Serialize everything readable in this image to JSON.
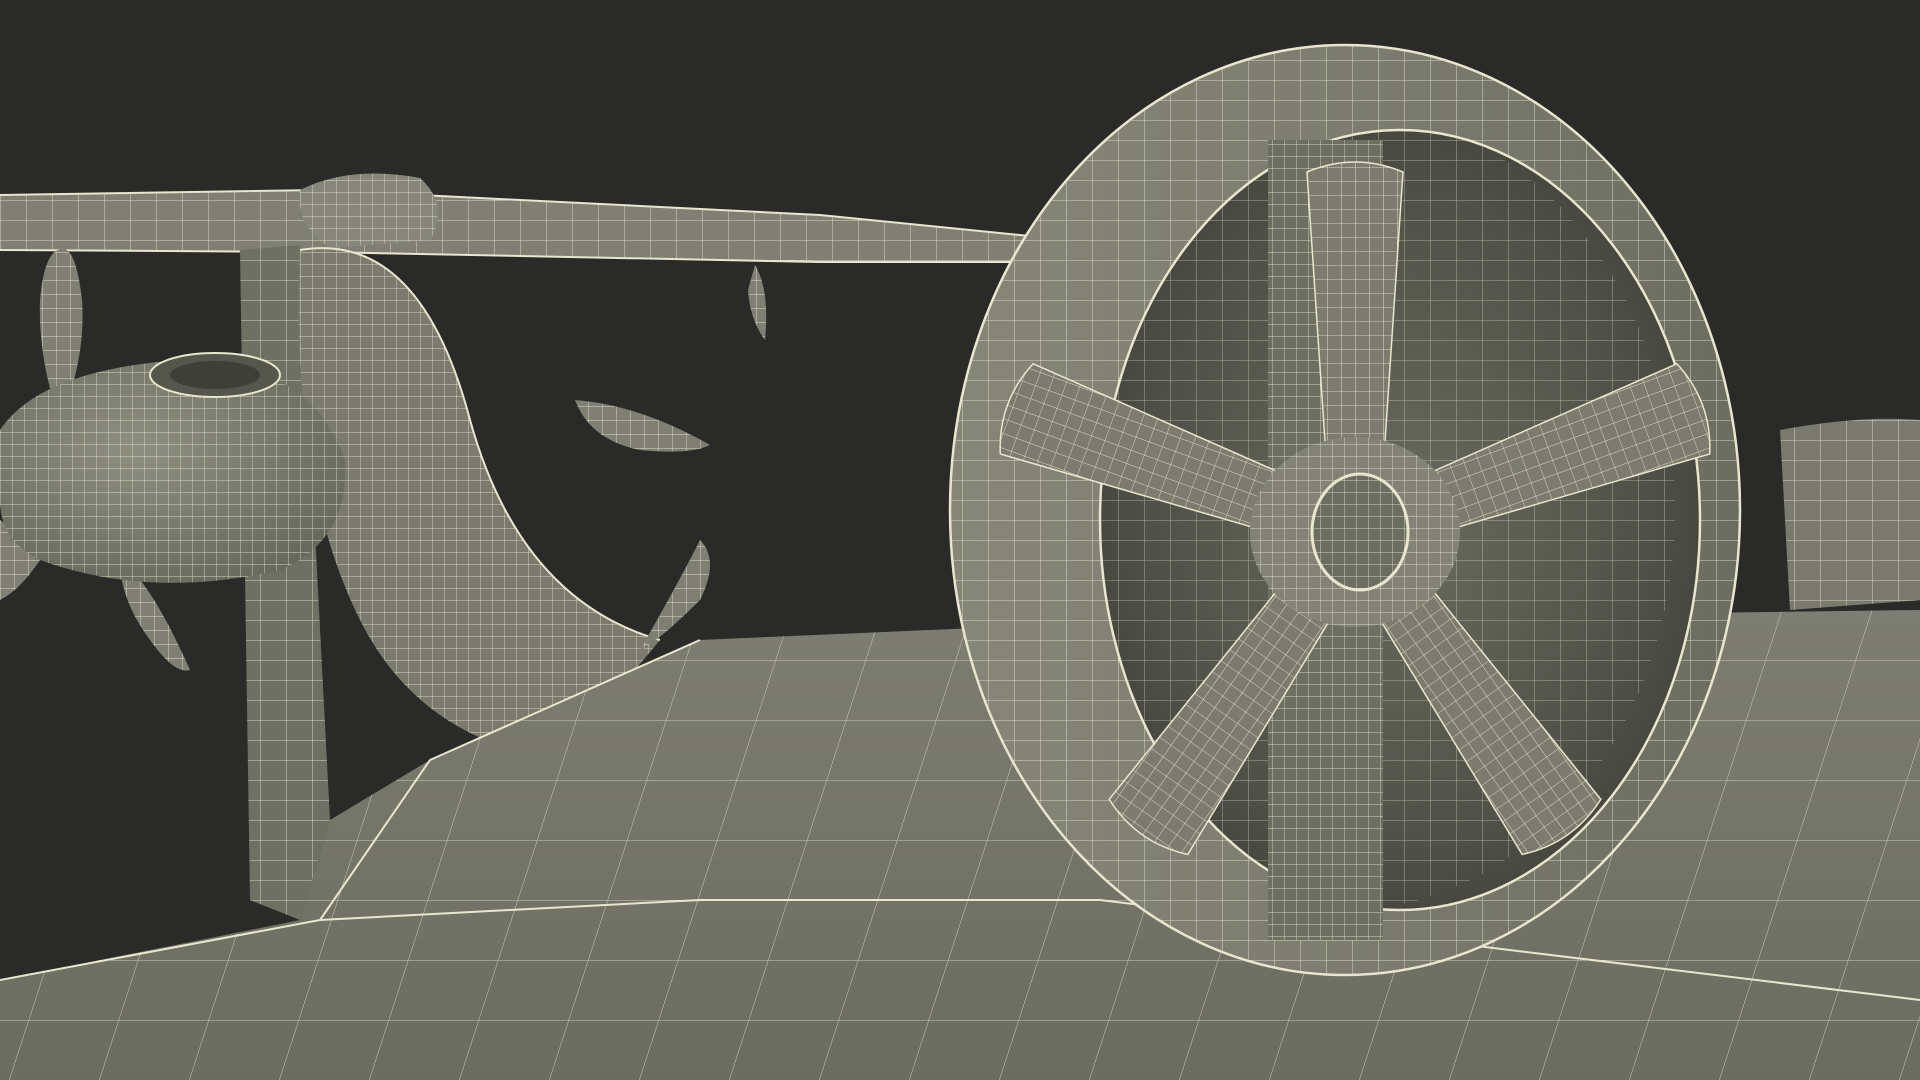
{
  "scene": {
    "subject": "wireframe-render",
    "colors": {
      "background": "#2a2a28",
      "surface": "#7b7c6f",
      "surface_dark": "#5f6055",
      "surface_shadow": "#4a4b42",
      "surface_light": "#8d8e80",
      "wire": "#e9e6cf"
    }
  }
}
